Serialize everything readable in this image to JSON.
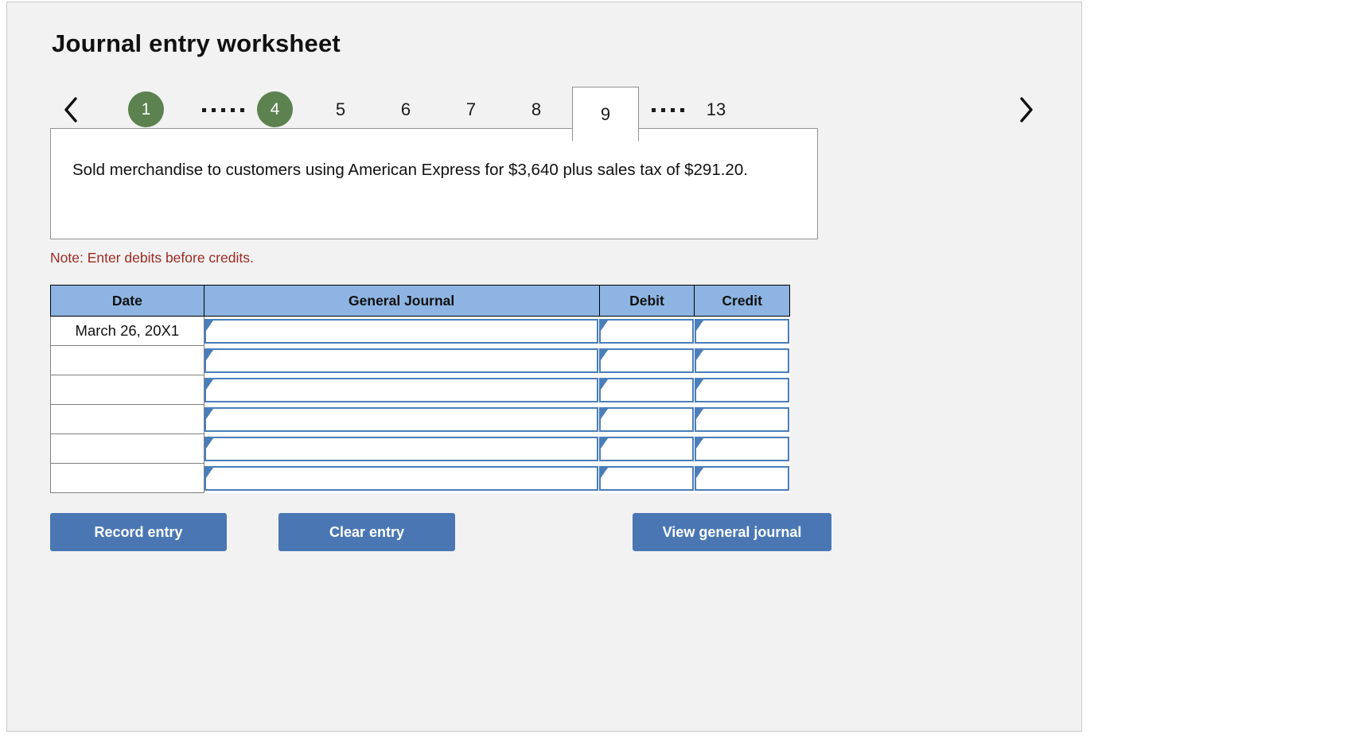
{
  "title": "Journal entry worksheet",
  "pager": {
    "prev_icon": "chevron-left-icon",
    "next_icon": "chevron-right-icon",
    "items": [
      {
        "label": "1",
        "state": "done"
      },
      {
        "label": "",
        "state": "dots"
      },
      {
        "label": "4",
        "state": "done"
      },
      {
        "label": "5",
        "state": "plain"
      },
      {
        "label": "6",
        "state": "plain"
      },
      {
        "label": "7",
        "state": "plain"
      },
      {
        "label": "8",
        "state": "plain"
      },
      {
        "label": "9",
        "state": "active"
      },
      {
        "label": "",
        "state": "dots"
      },
      {
        "label": "13",
        "state": "plain"
      }
    ]
  },
  "description": "Sold merchandise to customers using American Express for $3,640 plus sales tax of $291.20.",
  "note": "Note: Enter debits before credits.",
  "table": {
    "headers": [
      "Date",
      "General Journal",
      "Debit",
      "Credit"
    ],
    "rows": [
      {
        "date": "March 26, 20X1",
        "general_journal": "",
        "debit": "",
        "credit": ""
      },
      {
        "date": "",
        "general_journal": "",
        "debit": "",
        "credit": ""
      },
      {
        "date": "",
        "general_journal": "",
        "debit": "",
        "credit": ""
      },
      {
        "date": "",
        "general_journal": "",
        "debit": "",
        "credit": ""
      },
      {
        "date": "",
        "general_journal": "",
        "debit": "",
        "credit": ""
      },
      {
        "date": "",
        "general_journal": "",
        "debit": "",
        "credit": ""
      }
    ]
  },
  "buttons": {
    "record": "Record entry",
    "clear": "Clear entry",
    "view": "View general journal"
  },
  "colors": {
    "tab_done": "#5c8250",
    "header_fill": "#8db4e2",
    "button": "#4a77b4",
    "note": "#9c2a22",
    "input_border": "#4a7ebb"
  }
}
